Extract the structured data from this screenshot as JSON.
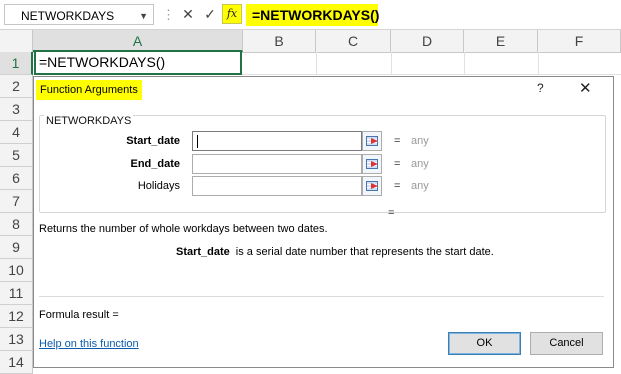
{
  "formula_bar": {
    "name_box": "NETWORKDAYS",
    "fx_label": "fx",
    "formula": "=NETWORKDAYS()"
  },
  "columns": [
    "A",
    "B",
    "C",
    "D",
    "E",
    "F"
  ],
  "rows": [
    "1",
    "2",
    "3",
    "4",
    "5",
    "6",
    "7",
    "8",
    "9",
    "10",
    "11",
    "12",
    "13",
    "14"
  ],
  "cell_a1": "=NETWORKDAYS()",
  "dialog": {
    "title": "Function Arguments",
    "help_glyph": "?",
    "close_glyph": "✕",
    "function_name": "NETWORKDAYS",
    "args": [
      {
        "label": "Start_date",
        "value": "",
        "equals": "=",
        "result": "any"
      },
      {
        "label": "End_date",
        "value": "",
        "equals": "=",
        "result": "any"
      },
      {
        "label": "Holidays",
        "value": "",
        "equals": "=",
        "result": "any"
      }
    ],
    "lone_equals": "=",
    "description": "Returns the number of whole workdays between two dates.",
    "arg_help_name": "Start_date",
    "arg_help_text": "is a serial date number that represents the start date.",
    "formula_result": "Formula result =",
    "help_link": "Help on this function",
    "ok_label": "OK",
    "cancel_label": "Cancel"
  },
  "colors": {
    "highlight": "#ffff00",
    "excel_green": "#217346",
    "link_blue": "#0b5cad"
  }
}
